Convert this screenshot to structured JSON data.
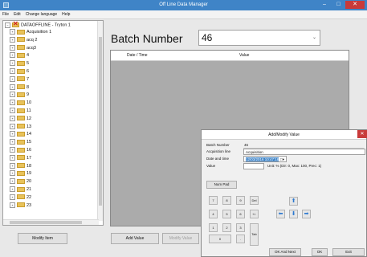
{
  "window": {
    "title": "Off Line Data Manager",
    "minimize": "–",
    "maximize": "□",
    "close": "✕",
    "close_color": "#c93a3a",
    "accent": "#3f84c7"
  },
  "menu": [
    "File",
    "Edit",
    "Change language",
    "Help"
  ],
  "tree": {
    "root": "DATAOFFLINE - Tryton 1",
    "items": [
      "Acquisition 1",
      "acq 2",
      "acq3",
      "4",
      "5",
      "6",
      "7",
      "8",
      "9",
      "10",
      "11",
      "12",
      "13",
      "14",
      "15",
      "16",
      "17",
      "18",
      "19",
      "20",
      "21",
      "22",
      "23"
    ]
  },
  "batch": {
    "label": "Batch Number",
    "value": "46",
    "chevron": "⌄"
  },
  "grid": {
    "columns": [
      "Date / Time",
      "Value"
    ]
  },
  "buttons": {
    "modify_item": "Modify Item",
    "add_value": "Add Value",
    "modify_value": "Modify Value"
  },
  "dialog": {
    "title": "Add/Modify Value",
    "close": "✕",
    "batch_label": "Batch Number",
    "batch_value": "46",
    "acq_label": "Acquisition line",
    "acq_value": "Acquisition",
    "date_label": "Date and time",
    "date_value": "12/03/2016 10:47:18",
    "date_icon": "□▾",
    "value_label": "Value",
    "value_value": "",
    "unit_text": "Unit: % (Dir: 0, Max: 100, Prec: 1)",
    "numpad_label": "Num Pad",
    "keys": [
      "7",
      "8",
      "9",
      "Del",
      "4",
      "5",
      "6",
      "+/-",
      "1",
      "2",
      "3",
      "Tab",
      "0",
      "."
    ],
    "arrows": {
      "up": "⬆",
      "left": "⬅",
      "down": "⬇",
      "right": "➡"
    },
    "ok_add_next": "OK And Next",
    "ok": "OK",
    "exit": "Exit"
  }
}
